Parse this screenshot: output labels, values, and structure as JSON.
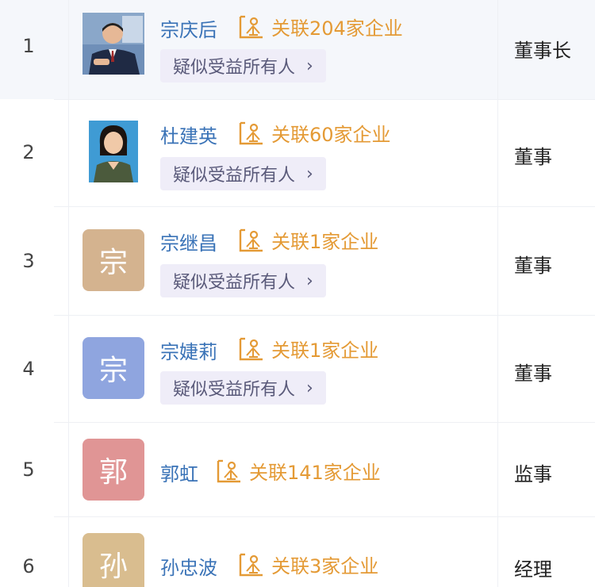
{
  "rows": [
    {
      "num": "1",
      "name": "宗庆后",
      "association": "关联204家企业",
      "badge": "疑似受益所有人",
      "role": "董事长",
      "avatar_type": "photo"
    },
    {
      "num": "2",
      "name": "杜建英",
      "association": "关联60家企业",
      "badge": "疑似受益所有人",
      "role": "董事",
      "avatar_type": "photo"
    },
    {
      "num": "3",
      "name": "宗继昌",
      "association": "关联1家企业",
      "badge": "疑似受益所有人",
      "role": "董事",
      "avatar_type": "letter",
      "avatar_char": "宗",
      "avatar_color": "#d4b38f"
    },
    {
      "num": "4",
      "name": "宗婕莉",
      "association": "关联1家企业",
      "badge": "疑似受益所有人",
      "role": "董事",
      "avatar_type": "letter",
      "avatar_char": "宗",
      "avatar_color": "#8fa5df"
    },
    {
      "num": "5",
      "name": "郭虹",
      "association": "关联141家企业",
      "role": "监事",
      "avatar_type": "letter",
      "avatar_char": "郭",
      "avatar_color": "#e09595"
    },
    {
      "num": "6",
      "name": "孙忠波",
      "association": "关联3家企业",
      "role": "经理",
      "avatar_type": "letter",
      "avatar_char": "孙",
      "avatar_color": "#d9bd8f"
    }
  ],
  "icons": {
    "association": "enterprise-link-icon",
    "badge_chevron": "chevron-right-icon"
  },
  "colors": {
    "name": "#3a73b7",
    "association": "#e49a35",
    "badge_bg": "#efedf8"
  }
}
